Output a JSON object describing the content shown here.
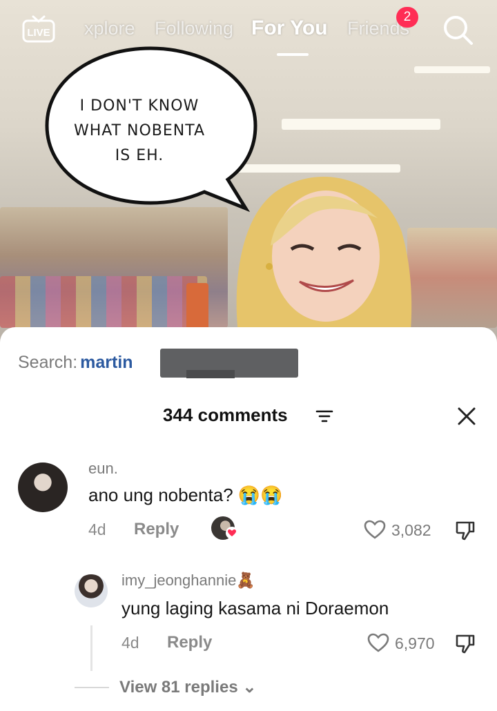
{
  "nav": {
    "live_label": "LIVE",
    "tabs": [
      {
        "label": "xplore"
      },
      {
        "label": "Following"
      },
      {
        "label": "For You",
        "active": true
      },
      {
        "label": "Friends",
        "badge": "2"
      }
    ]
  },
  "video": {
    "speech_bubble_text": "I DON'T KNOW\nWHAT NOBENTA\nIS EH."
  },
  "search": {
    "label": "Search:",
    "term": "martin"
  },
  "comments": {
    "title": "344 comments",
    "items": [
      {
        "username": "eun.",
        "text": "ano ung nobenta? 😭😭",
        "time": "4d",
        "reply_label": "Reply",
        "likes": "3,082"
      },
      {
        "username": "imy_jeonghannie🧸",
        "text": "yung laging kasama ni Doraemon",
        "time": "4d",
        "reply_label": "Reply",
        "likes": "6,970"
      }
    ],
    "view_replies": "View 81 replies ⌄"
  },
  "colors": {
    "badge": "#ff2d55",
    "search_term": "#2c5aa0"
  }
}
